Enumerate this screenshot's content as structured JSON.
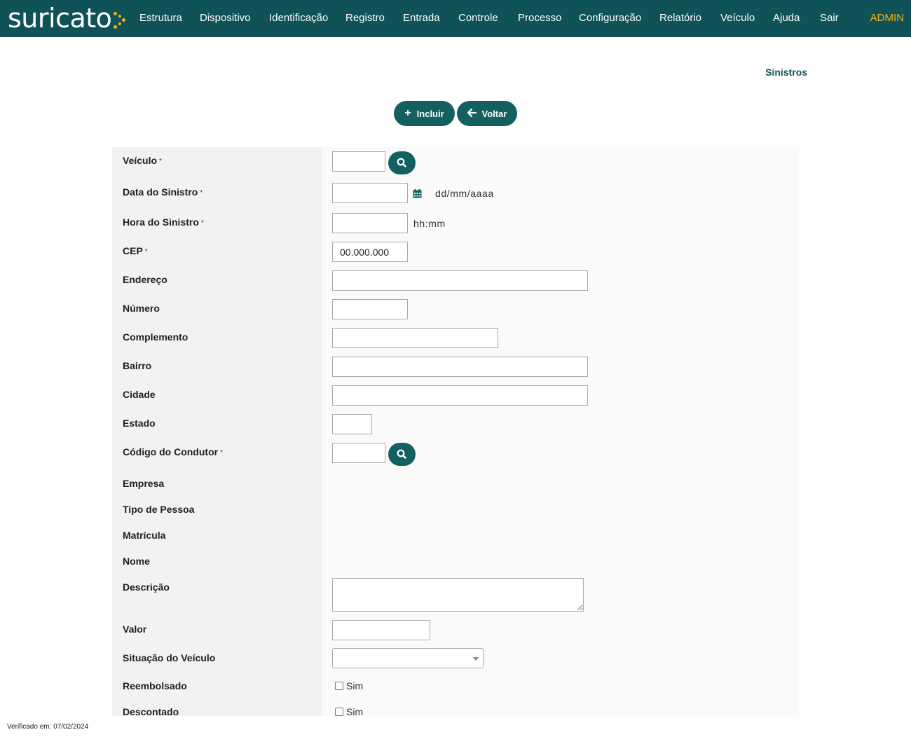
{
  "app": {
    "logo_text": "suricato"
  },
  "nav": {
    "items": [
      "Estrutura",
      "Dispositivo",
      "Identificação",
      "Registro",
      "Entrada",
      "Controle",
      "Processo",
      "Configuração",
      "Relatório",
      "Veículo",
      "Ajuda",
      "Sair"
    ],
    "user": "ADMIN"
  },
  "page": {
    "title": "Sinistros"
  },
  "actions": {
    "include_label": "Incluir",
    "back_label": "Voltar"
  },
  "form": {
    "required_mark": "*",
    "labels": {
      "veiculo": "Veículo",
      "data_sinistro": "Data do Sinistro",
      "hora_sinistro": "Hora do Sinistro",
      "cep": "CEP",
      "endereco": "Endereço",
      "numero": "Número",
      "complemento": "Complemento",
      "bairro": "Bairro",
      "cidade": "Cidade",
      "estado": "Estado",
      "codigo_condutor": "Código do Condutor",
      "empresa": "Empresa",
      "tipo_pessoa": "Tipo de Pessoa",
      "matricula": "Matrícula",
      "nome": "Nome",
      "descricao": "Descrição",
      "valor": "Valor",
      "situacao_veiculo": "Situação do Veículo",
      "reembolsado": "Reembolsado",
      "descontado": "Descontado"
    },
    "values": {
      "cep": "00.000.000",
      "situacao_veiculo": "",
      "reembolsado": false,
      "descontado": false
    },
    "hints": {
      "date_format": "dd/mm/aaaa",
      "time_format": "hh:mm"
    },
    "checkbox_label": "Sim"
  },
  "footer": {
    "verified": "Verificado em: 07/02/2024"
  },
  "colors": {
    "brand": "#0f5257",
    "button": "#12605f",
    "accent": "#f2b21b"
  },
  "icons": {
    "search": "search-icon",
    "calendar": "calendar-icon",
    "plus": "plus-icon",
    "back": "arrow-left-icon"
  }
}
